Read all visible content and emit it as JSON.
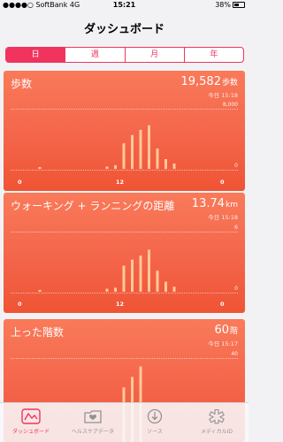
{
  "status": {
    "carrier": "●●●●○ SoftBank",
    "network": "4G",
    "time": "15:21",
    "battery": "38%"
  },
  "nav": {
    "title": "ダッシュボード"
  },
  "segments": {
    "day": "日",
    "week": "週",
    "month": "月",
    "year": "年",
    "selected": "日"
  },
  "cards": [
    {
      "title": "歩数",
      "value": "19,582",
      "unit": "歩数",
      "updated": "今日 15:18",
      "axis_max": "8,000",
      "axis_min": "0",
      "chart_data": {
        "type": "bar",
        "x": [
          0,
          12,
          24
        ],
        "xlabels": [
          "0",
          "12",
          "0"
        ],
        "ylim": [
          0,
          8000
        ],
        "series": [
          {
            "values": [
              [
                2,
                80
              ],
              [
                10,
                300
              ],
              [
                11,
                480
              ],
              [
                12,
                3400
              ],
              [
                13,
                4500
              ],
              [
                14,
                5200
              ],
              [
                15,
                5800
              ],
              [
                16,
                2700
              ],
              [
                17,
                1300
              ],
              [
                18,
                700
              ]
            ]
          }
        ]
      }
    },
    {
      "title": "ウォーキング + ランニングの距離",
      "value": "13.74",
      "unit": "km",
      "updated": "今日 15:18",
      "axis_max": "6",
      "axis_min": "0",
      "chart_data": {
        "type": "bar",
        "x": [
          0,
          12,
          24
        ],
        "xlabels": [
          "0",
          "12",
          "0"
        ],
        "ylim": [
          0,
          6
        ],
        "series": [
          {
            "values": [
              [
                2,
                0.1
              ],
              [
                10,
                0.3
              ],
              [
                11,
                0.4
              ],
              [
                12,
                2.6
              ],
              [
                13,
                3.2
              ],
              [
                14,
                3.6
              ],
              [
                15,
                4.2
              ],
              [
                16,
                2.1
              ],
              [
                17,
                1.0
              ],
              [
                18,
                0.5
              ]
            ]
          }
        ]
      }
    },
    {
      "title": "上った階数",
      "value": "60",
      "unit": "階",
      "updated": "今日 15:17",
      "axis_max": "40",
      "chart_data": {
        "type": "bar",
        "ylim": [
          0,
          40
        ],
        "series": [
          {
            "values": [
              [
                12,
                26
              ],
              [
                13,
                31
              ],
              [
                14,
                36
              ]
            ]
          }
        ]
      }
    }
  ],
  "tabs": [
    {
      "label": "ダッシュボード",
      "icon": "dashboard-icon"
    },
    {
      "label": "ヘルスケアデータ",
      "icon": "health-data-icon"
    },
    {
      "label": "ソース",
      "icon": "sources-icon"
    },
    {
      "label": "メディカルID",
      "icon": "medical-id-icon"
    }
  ],
  "colors": {
    "accent": "#f0345d",
    "card": "#f4654a"
  }
}
